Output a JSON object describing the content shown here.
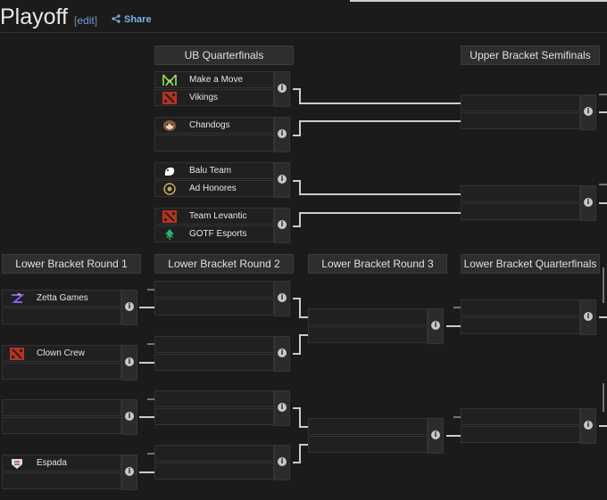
{
  "header": {
    "title": "Playoff",
    "edit_open": "[",
    "edit_label": "edit",
    "edit_close": "]",
    "share_label": "Share"
  },
  "rounds": {
    "ub_quarterfinals": "UB Quarterfinals",
    "ub_semifinals": "Upper Bracket Semifinals",
    "lb_round1": "Lower Bracket Round 1",
    "lb_round2": "Lower Bracket Round 2",
    "lb_round3": "Lower Bracket Round 3",
    "lb_quarterfinals": "Lower Bracket Quarterfinals"
  },
  "teams": {
    "make_a_move": "Make a Move",
    "vikings": "Vikings",
    "chandogs": "Chandogs",
    "balu_team": "Balu Team",
    "ad_honores": "Ad Honores",
    "team_levantic": "Team Levantic",
    "gotf_esports": "GOTF Esports",
    "zetta_games": "Zetta Games",
    "clown_crew": "Clown Crew",
    "espada": "Espada"
  },
  "info_glyph": "i",
  "colors": {
    "background": "#1b1b1b",
    "connector": "#cccccc",
    "link": "#6b9fd8"
  }
}
